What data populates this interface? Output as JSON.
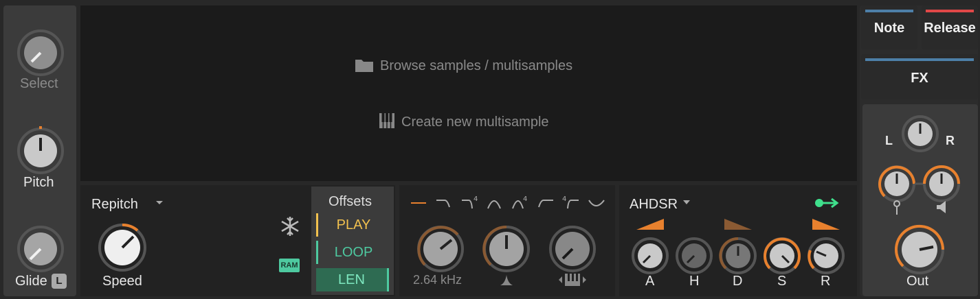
{
  "left": {
    "select_label": "Select",
    "pitch_label": "Pitch",
    "glide_label": "Glide",
    "glide_badge": "L"
  },
  "browser": {
    "browse_label": "Browse samples / multisamples",
    "create_label": "Create new multisample"
  },
  "sampler": {
    "mode": "Repitch",
    "speed_label": "Speed",
    "ram_label": "RAM",
    "offsets_title": "Offsets",
    "play_label": "PLAY",
    "loop_label": "LOOP",
    "len_label": "LEN",
    "colors": {
      "play": "#f2c14e",
      "loop": "#4ec9a0",
      "len_bg": "#2e6b52"
    }
  },
  "filter": {
    "cutoff_value": "2.64 kHz",
    "shape_icons": [
      "flat-line-icon",
      "lowpass-icon",
      "lowpass-4-icon",
      "bandpass-icon",
      "bandpass-4-icon",
      "highpass-icon",
      "highpass-4-icon",
      "notch-icon"
    ]
  },
  "envelope": {
    "type": "AHDSR",
    "labels": [
      "A",
      "H",
      "D",
      "S",
      "R"
    ]
  },
  "tabs": {
    "note": "Note",
    "release": "Release",
    "fx": "FX"
  },
  "output": {
    "left_label": "L",
    "right_label": "R",
    "out_label": "Out"
  },
  "colors": {
    "accent": "#e8812e",
    "note_bar": "#4d7fa8",
    "release_bar": "#e04848",
    "green": "#3fe08c"
  }
}
